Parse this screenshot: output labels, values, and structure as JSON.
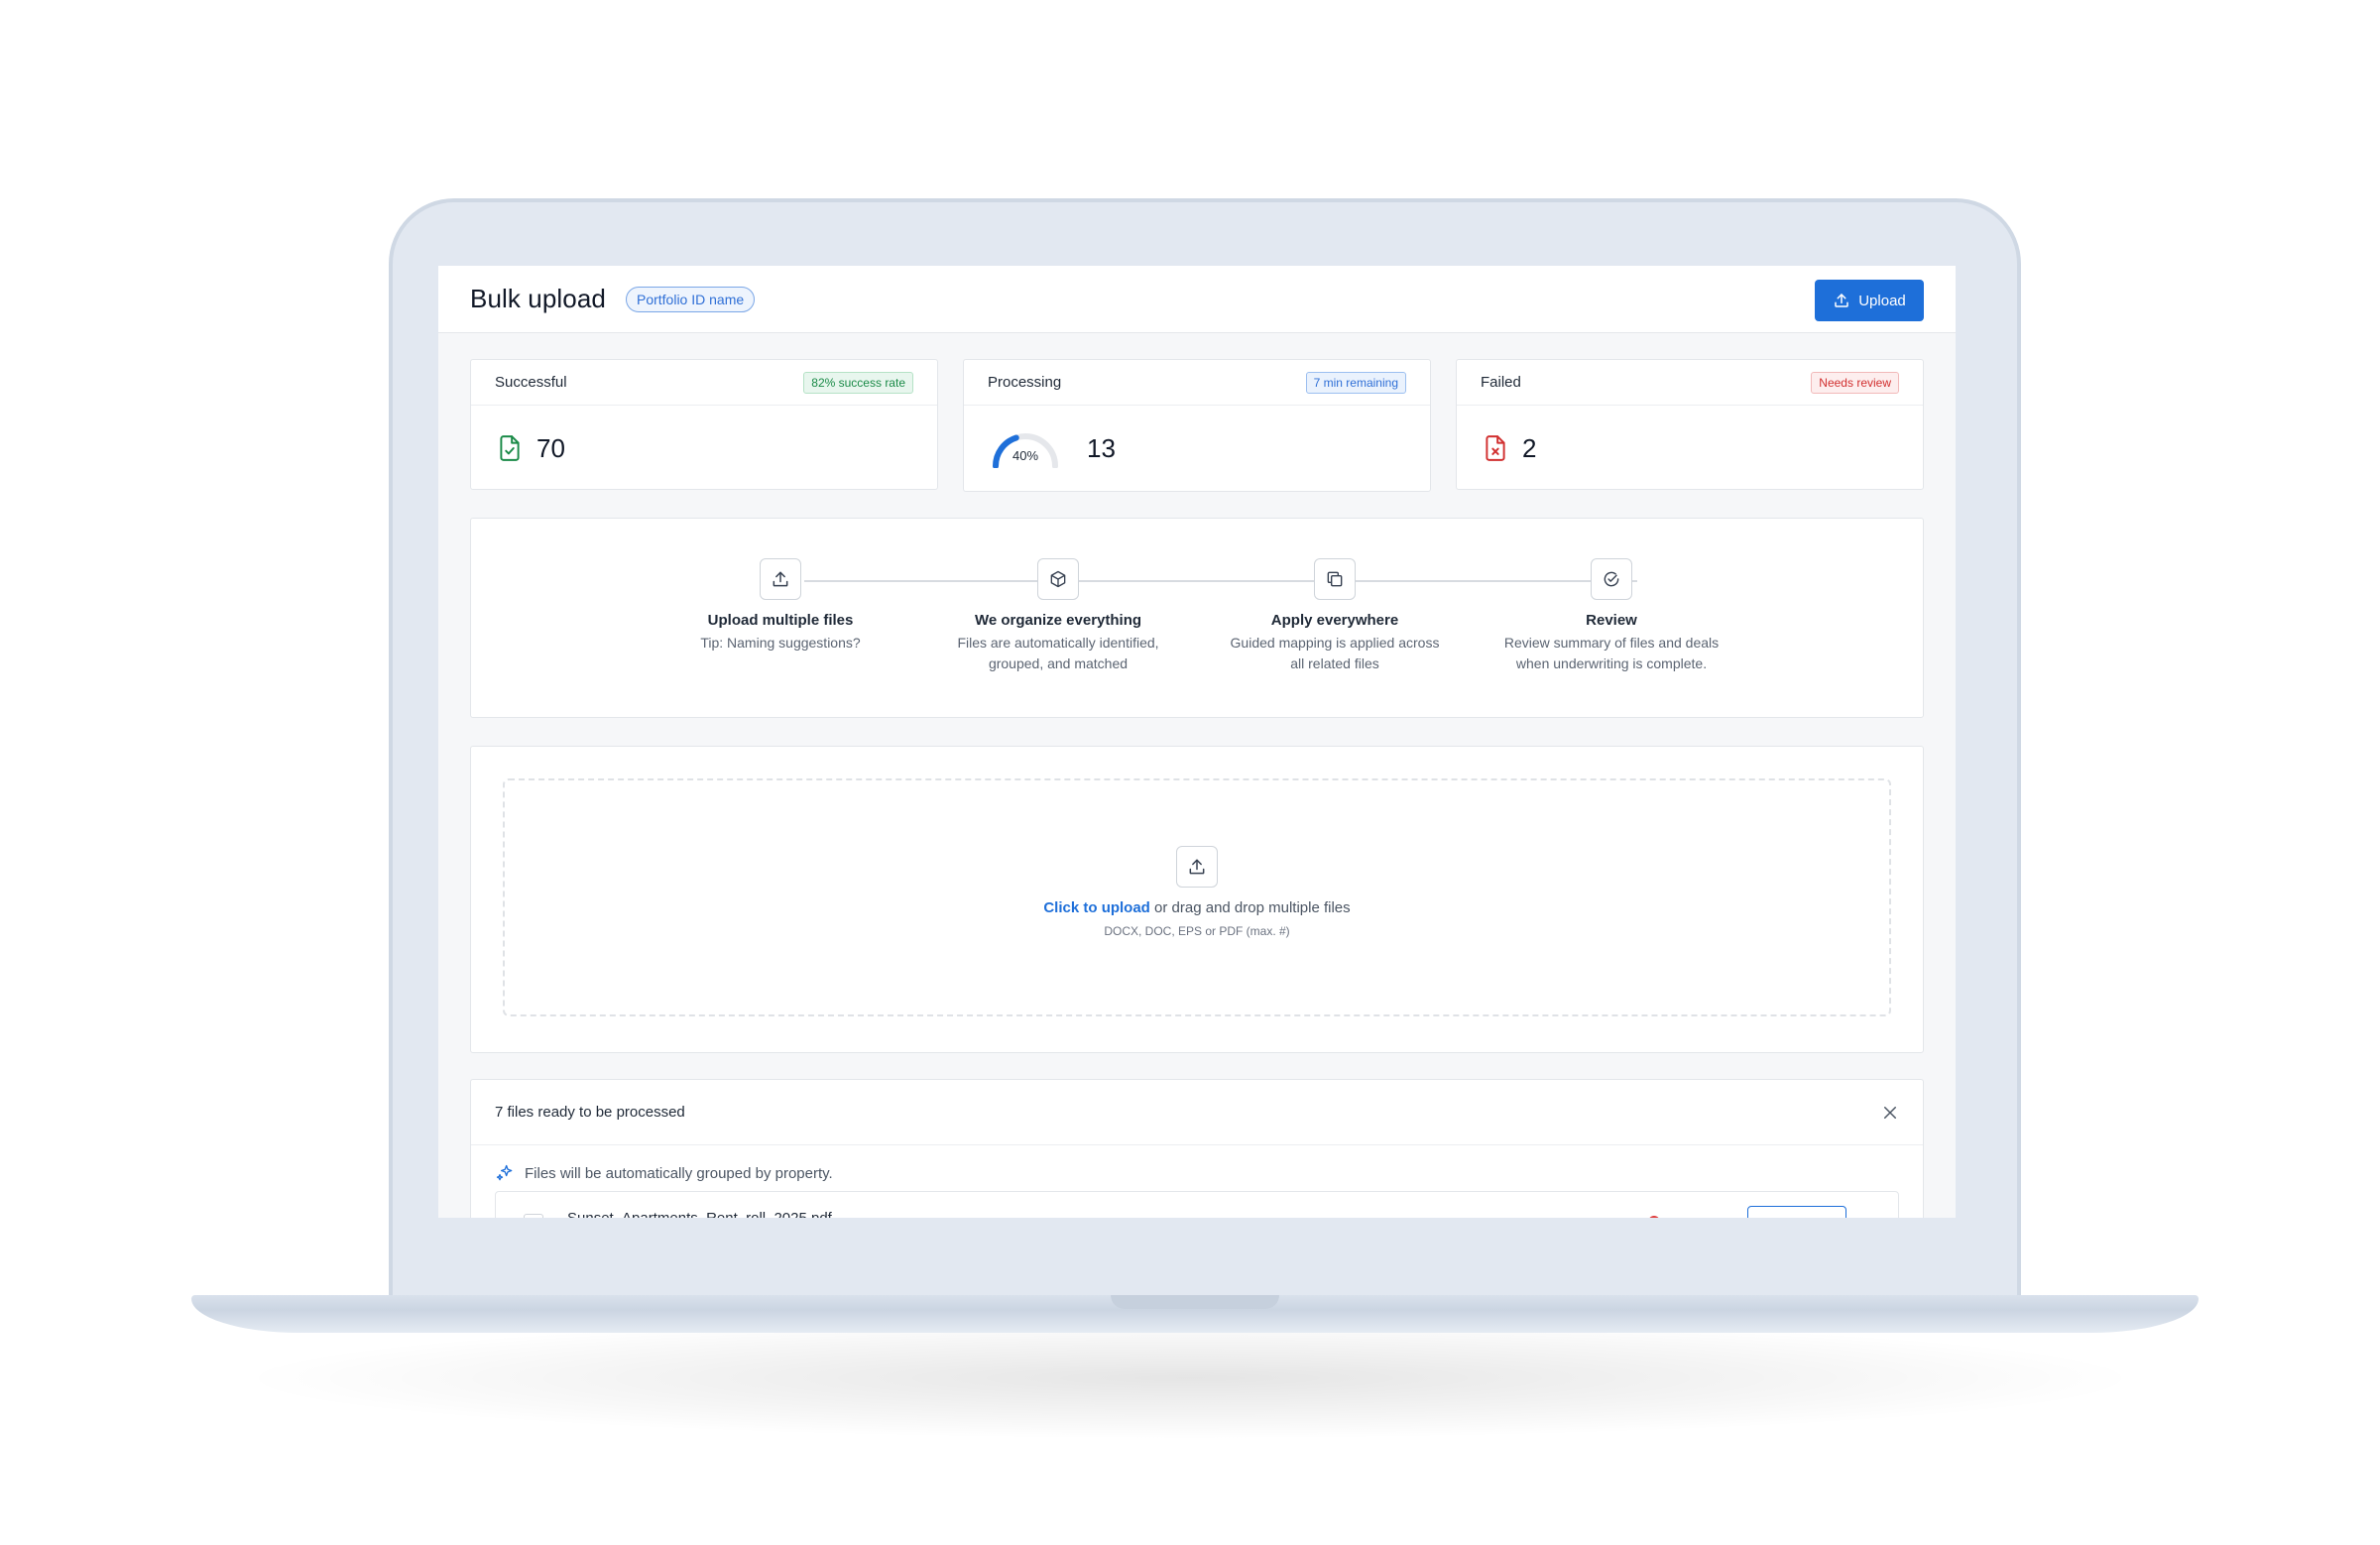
{
  "header": {
    "title": "Bulk upload",
    "portfolio_badge": "Portfolio ID name",
    "upload_label": "Upload"
  },
  "stats": {
    "successful": {
      "title": "Successful",
      "tag": "82% success rate",
      "value": "70"
    },
    "processing": {
      "title": "Processing",
      "tag": "7 min remaining",
      "progress_label": "40%",
      "progress": 0.4,
      "value": "13"
    },
    "failed": {
      "title": "Failed",
      "tag": "Needs review",
      "value": "2"
    }
  },
  "steps": [
    {
      "icon": "upload-icon",
      "title": "Upload multiple files",
      "desc": [
        "Tip: Naming suggestions?"
      ]
    },
    {
      "icon": "cube-icon",
      "title": "We organize everything",
      "desc": [
        "Files are automatically identified,",
        "grouped, and matched"
      ]
    },
    {
      "icon": "copy-icon",
      "title": "Apply everywhere",
      "desc": [
        "Guided mapping is applied across",
        "all related files"
      ]
    },
    {
      "icon": "check-circle-icon",
      "title": "Review",
      "desc": [
        "Review summary of files and deals",
        "when underwriting is complete."
      ]
    }
  ],
  "dropzone": {
    "link": "Click to upload",
    "text": " or drag and drop multiple files",
    "hint": "DOCX, DOC, EPS or PDF (max. #)"
  },
  "files": {
    "title": "7 files ready to be processed",
    "note": "Files will be automatically grouped by property.",
    "rows": [
      {
        "name": "Sunset_Apartments_Rent_roll_2025.pdf"
      }
    ]
  },
  "colors": {
    "accent": "#1e6fd9",
    "success": "#1a8a47",
    "danger": "#d12f2f"
  }
}
